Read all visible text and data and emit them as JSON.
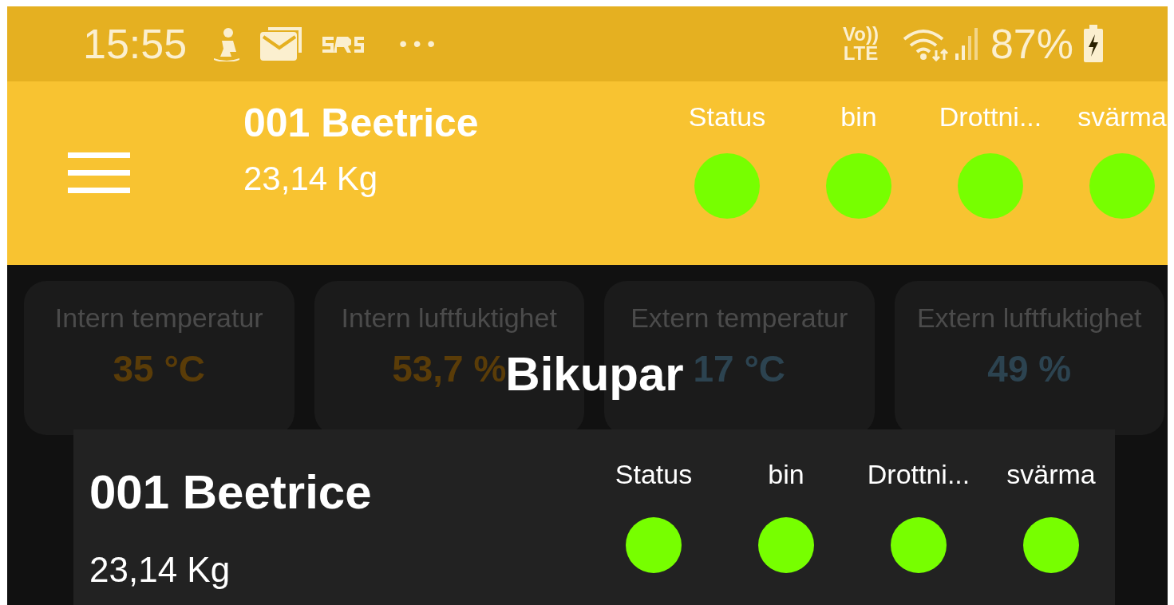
{
  "status_bar": {
    "time": "15:55",
    "more": "• • •",
    "network_top": "Vo))",
    "network_bottom": "LTE",
    "battery": "87%"
  },
  "header": {
    "title": "001 Beetrice",
    "weight": "23,14 Kg",
    "indicators": [
      {
        "label": "Status",
        "color": "#77ff00"
      },
      {
        "label": "bin",
        "color": "#77ff00"
      },
      {
        "label": "Drottni...",
        "color": "#77ff00"
      },
      {
        "label": "svärma",
        "color": "#77ff00"
      }
    ]
  },
  "cards": [
    {
      "label": "Intern temperatur",
      "value": "35 °C",
      "color": "#5a3c08"
    },
    {
      "label": "Intern luftfuktighet",
      "value": "53,7 %",
      "color": "#5a3c08"
    },
    {
      "label": "Extern temperatur",
      "value": "17 °C",
      "color": "#2c4350"
    },
    {
      "label": "Extern luftfuktighet",
      "value": "49 %",
      "color": "#2c4350"
    }
  ],
  "dialog": {
    "title": "Bikupar",
    "items": [
      {
        "title": "001 Beetrice",
        "weight": "23,14 Kg",
        "indicators": [
          {
            "label": "Status",
            "color": "#77ff00"
          },
          {
            "label": "bin",
            "color": "#77ff00"
          },
          {
            "label": "Drottni...",
            "color": "#77ff00"
          },
          {
            "label": "svärma",
            "color": "#77ff00"
          }
        ]
      }
    ]
  }
}
